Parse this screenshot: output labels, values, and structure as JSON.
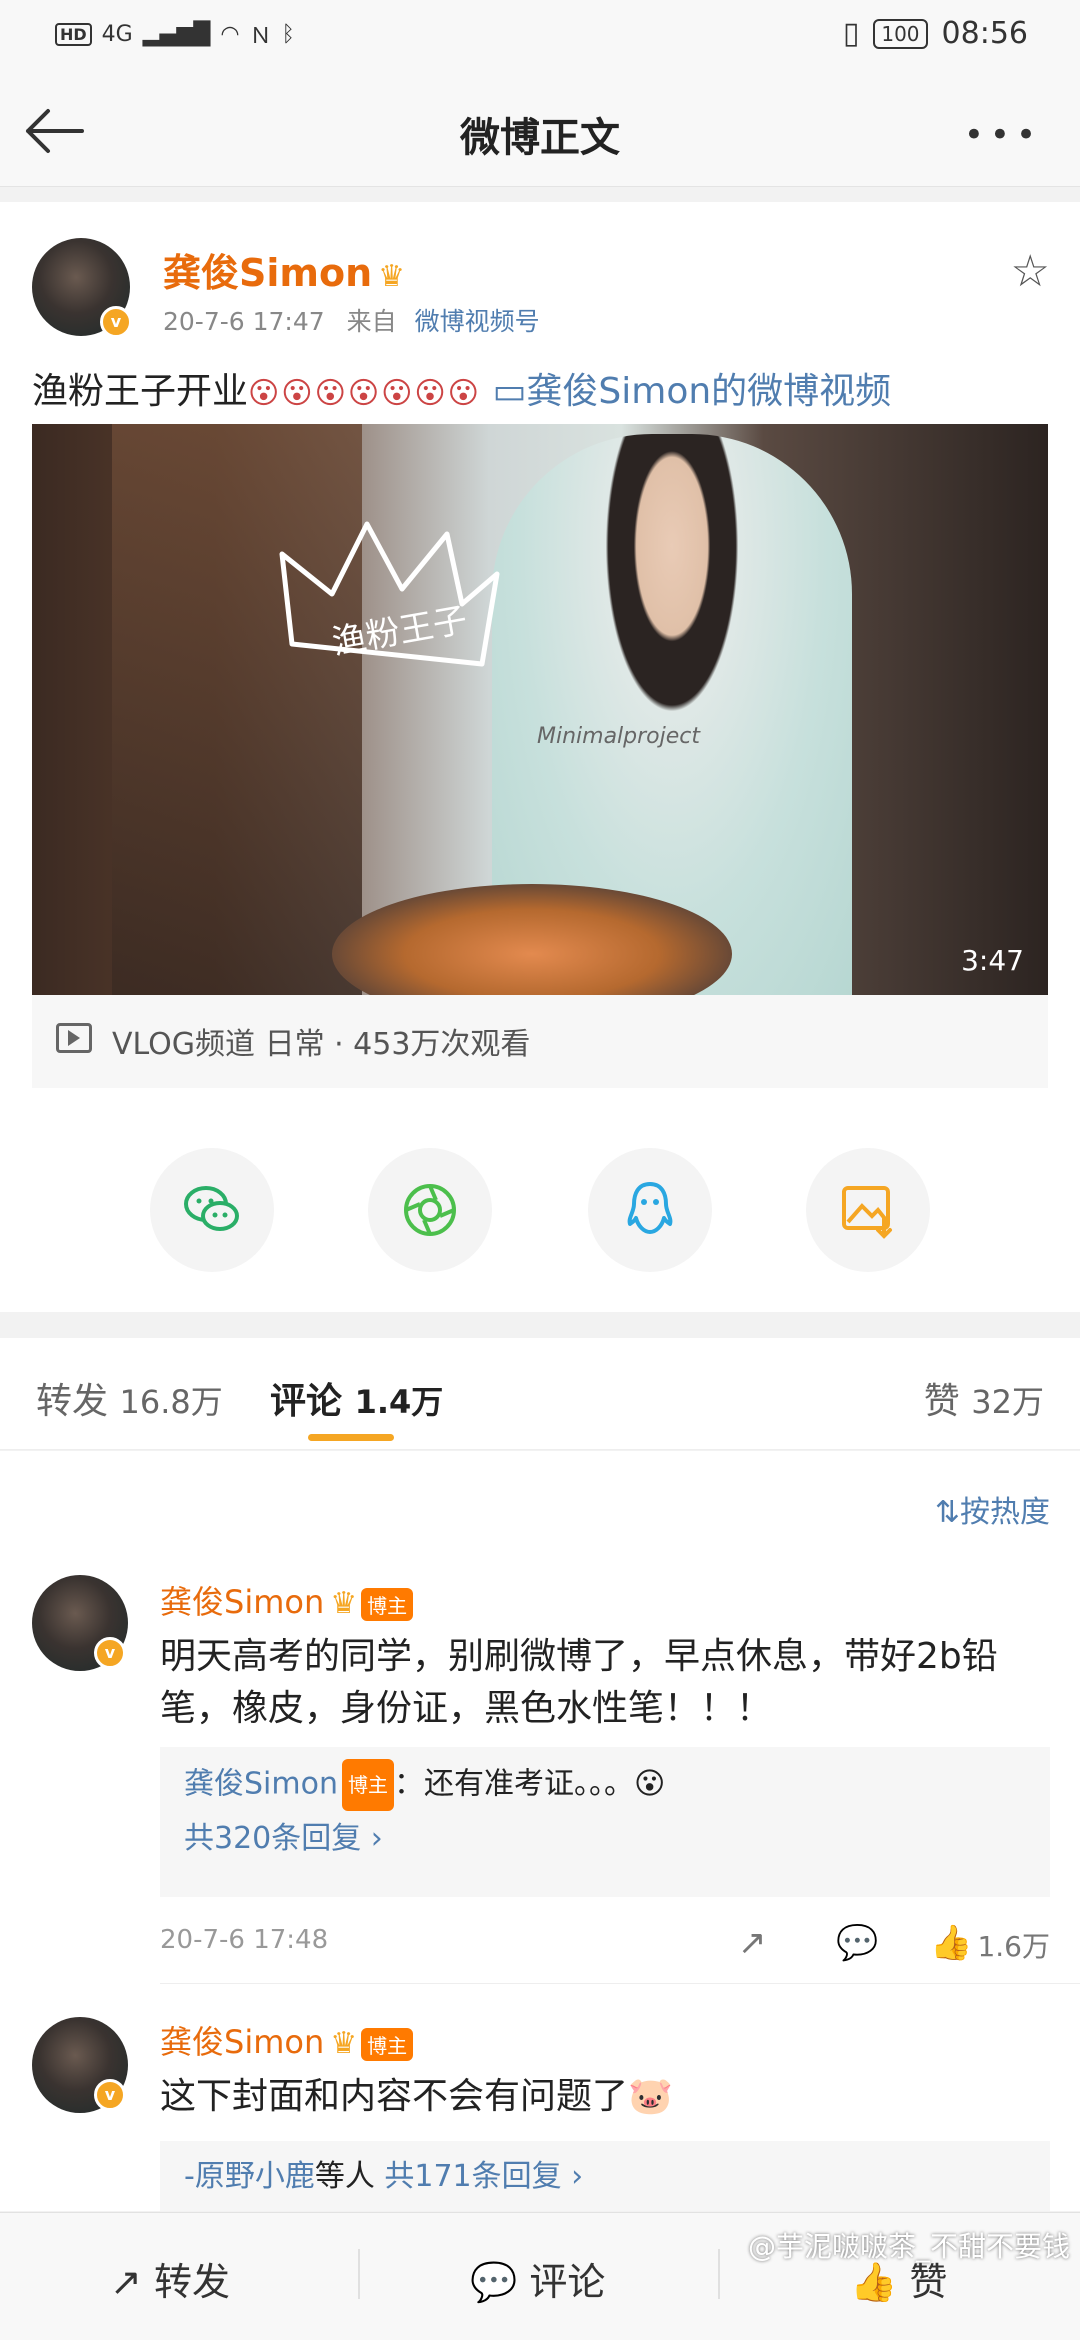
{
  "status_bar": {
    "left_icons": [
      "HD",
      "4G",
      "signal",
      "wifi",
      "NFC",
      "bluetooth"
    ],
    "battery": "100",
    "time": "08:56"
  },
  "nav": {
    "title": "微博正文"
  },
  "post": {
    "author": "龚俊Simon",
    "time": "20-7-6 17:47",
    "source_prefix": "来自",
    "source": "微博视频号",
    "text": "渔粉王子开业",
    "emojis": "😮😮😮😮😮😮😮",
    "video_link": "龚俊Simon的微博视频",
    "video": {
      "duration": "3:47",
      "shirt_print": "Minimalproject",
      "doodle_text": "渔粉王子"
    },
    "video_info": "VLOG频道 日常 · 453万次观看"
  },
  "share_buttons": [
    "wechat-icon",
    "moments-icon",
    "qq-icon",
    "save-image-icon"
  ],
  "tabs": [
    {
      "label": "转发",
      "count": "16.8万"
    },
    {
      "label": "评论",
      "count": "1.4万"
    },
    {
      "label": "赞",
      "count": "32万"
    }
  ],
  "sort_label": "按热度",
  "comments": [
    {
      "author": "龚俊Simon",
      "tag": "博主",
      "text": "明天高考的同学，别刷微博了，早点休息，带好2b铅笔，橡皮，身份证，黑色水性笔！！！",
      "reply_author": "龚俊Simon",
      "reply_tag": "博主",
      "reply_text": "：还有准考证。。。😮",
      "reply_count": "共320条回复 ›",
      "time": "20-7-6 17:48",
      "likes": "1.6万"
    },
    {
      "author": "龚俊Simon",
      "tag": "博主",
      "text": "这下封面和内容不会有问题了🐷",
      "reply_summary_name": "-原野小鹿",
      "reply_summary_suffix": "等人",
      "reply_count": "共171条回复 ›"
    }
  ],
  "bottom_bar": {
    "repost": "转发",
    "comment": "评论",
    "like": "赞"
  },
  "watermark": "@芋泥啵啵茶_不甜不要钱",
  "colors": {
    "accent": "#f5a623",
    "author": "#e86b0c",
    "link": "#507daf",
    "like_active": "#f5562a"
  }
}
